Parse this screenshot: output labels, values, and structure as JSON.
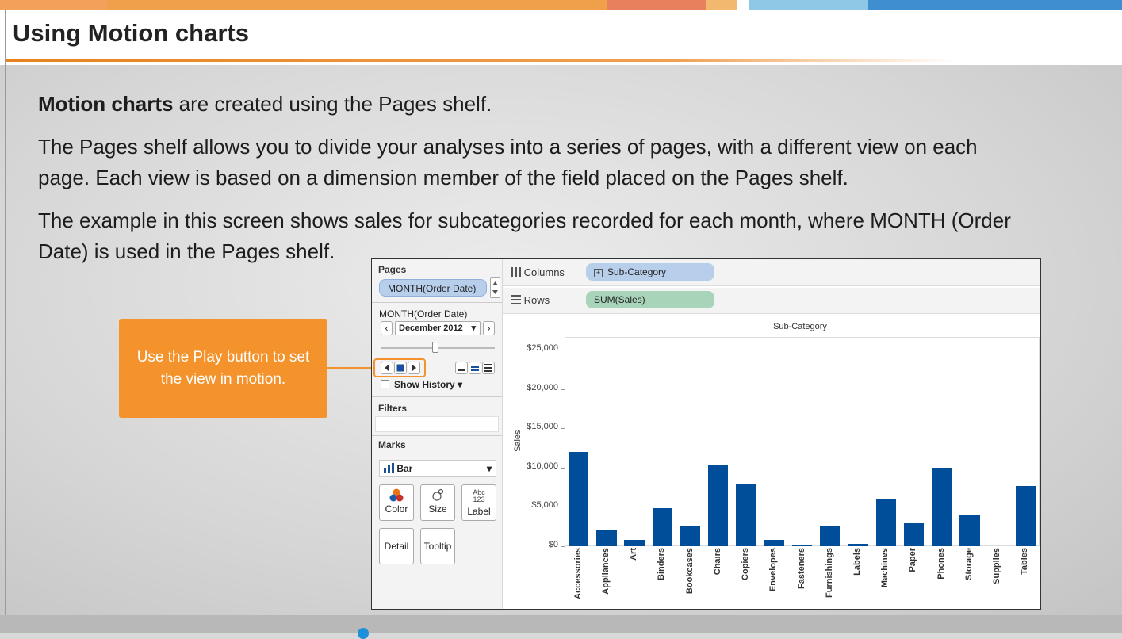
{
  "slide": {
    "title": "Using Motion charts",
    "p1_bold": "Motion charts",
    "p1_rest": " are created using the Pages shelf.",
    "p2_line1": "The Pages shelf allows you to divide your analyses into a series of pages, with a different view on each",
    "p2_line2": "page. Each view is based on a dimension member of the field placed on the Pages shelf.",
    "p3_line1": "The example in this screen shows sales for subcategories recorded for each month, where MONTH (Order",
    "p3_line2": "Date) is used in the Pages shelf.",
    "callout_line1": "Use the Play button to set",
    "callout_line2": "the view in motion."
  },
  "colors": {
    "accent_orange": "#f4922c",
    "bar_blue": "#004e9a",
    "dimension_pill": "#b8cfec",
    "measure_pill": "#a8d5ba"
  },
  "tableau": {
    "pages_label": "Pages",
    "pages_pill": "MONTH(Order Date)",
    "page_control_label": "MONTH(Order Date)",
    "page_value": "December 2012",
    "show_history": "Show History",
    "filters_label": "Filters",
    "marks_label": "Marks",
    "mark_type": "Bar",
    "mark_cards": {
      "color": "Color",
      "size": "Size",
      "label": "Label",
      "label_icon": "Abc 123",
      "detail": "Detail",
      "tooltip": "Tooltip"
    },
    "columns_label": "Columns",
    "columns_pill": "Sub-Category",
    "rows_label": "Rows",
    "rows_pill": "SUM(Sales)",
    "icons": {
      "play": "play-icon",
      "stop": "stop-icon",
      "back": "step-back-icon",
      "prev": "chevron-left-icon",
      "next": "chevron-right-icon"
    }
  },
  "chart_data": {
    "type": "bar",
    "title": "Sub-Category",
    "ylabel": "Sales",
    "ylim": [
      0,
      25000
    ],
    "yticks": [
      "$0",
      "$5,000",
      "$10,000",
      "$15,000",
      "$20,000",
      "$25,000"
    ],
    "categories": [
      "Accessories",
      "Appliances",
      "Art",
      "Binders",
      "Bookcases",
      "Chairs",
      "Copiers",
      "Envelopes",
      "Fasteners",
      "Furnishings",
      "Labels",
      "Machines",
      "Paper",
      "Phones",
      "Storage",
      "Supplies",
      "Tables"
    ],
    "values": [
      12000,
      2100,
      800,
      4800,
      2600,
      10400,
      8000,
      800,
      150,
      2500,
      300,
      5900,
      2900,
      10000,
      4000,
      0,
      7700
    ]
  }
}
